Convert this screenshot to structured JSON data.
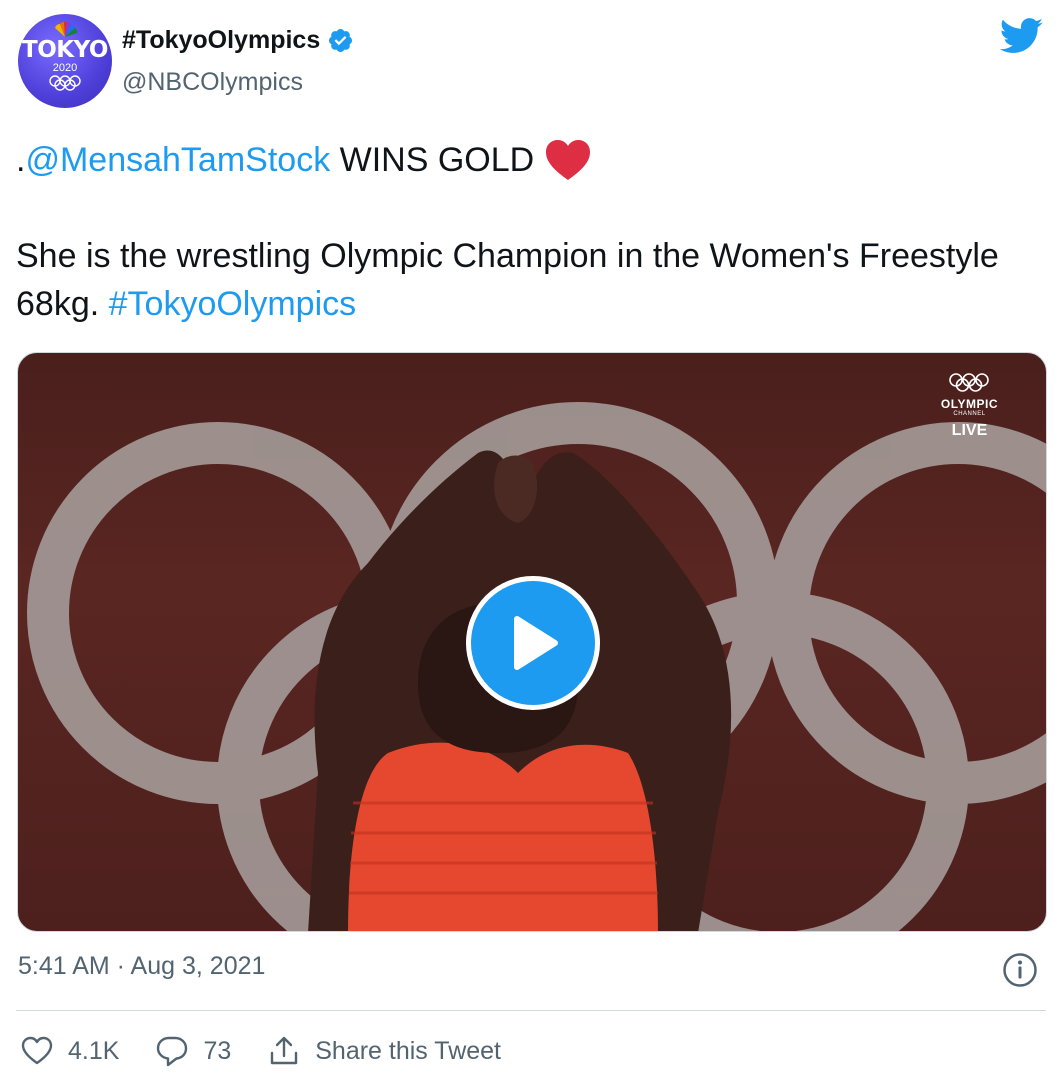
{
  "author": {
    "display_name": "#TokyoOlympics",
    "handle": "@NBCOlympics",
    "verified": true,
    "avatar": {
      "title": "TOKYO",
      "year": "2020"
    }
  },
  "tweet": {
    "prefix": ".",
    "mention": "@MensahTamStock",
    "headline": " WINS GOLD",
    "emoji": "red-heart",
    "body": "She is the wrestling Olympic Champion in the Women's Freestyle 68kg. ",
    "hashtag": "#TokyoOlympics"
  },
  "media": {
    "type": "video",
    "channel_name": "OLYMPIC",
    "channel_sub": "CHANNEL",
    "live_label": "LIVE"
  },
  "timestamp": "5:41 AM · Aug 3, 2021",
  "actions": {
    "likes": "4.1K",
    "replies": "73",
    "share_label": "Share this Tweet"
  },
  "colors": {
    "accent": "#1d9bf0",
    "text": "#0f1419",
    "muted": "#536471",
    "heart": "#e0245e"
  }
}
